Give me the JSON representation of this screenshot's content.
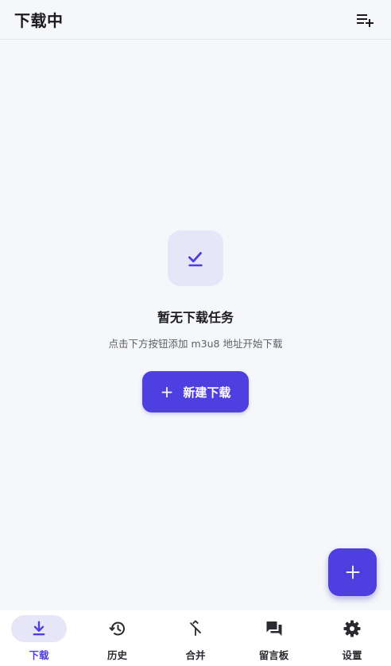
{
  "header": {
    "title": "下载中",
    "add_queue_icon": "playlist-add-icon"
  },
  "empty": {
    "icon": "check-download-icon",
    "title": "暂无下载任务",
    "subtitle": "点击下方按钮添加 m3u8 地址开始下载",
    "button_label": "新建下载",
    "button_icon": "plus-icon"
  },
  "fab": {
    "icon": "plus-icon"
  },
  "nav": {
    "items": [
      {
        "label": "下载",
        "icon": "download-icon",
        "active": true
      },
      {
        "label": "历史",
        "icon": "history-icon",
        "active": false
      },
      {
        "label": "合并",
        "icon": "merge-icon",
        "active": false
      },
      {
        "label": "留言板",
        "icon": "forum-icon",
        "active": false
      },
      {
        "label": "设置",
        "icon": "settings-icon",
        "active": false
      }
    ]
  },
  "colors": {
    "accent": "#4d3fe0",
    "accent_light": "#e7e6f8",
    "background": "#f6f7fa"
  }
}
